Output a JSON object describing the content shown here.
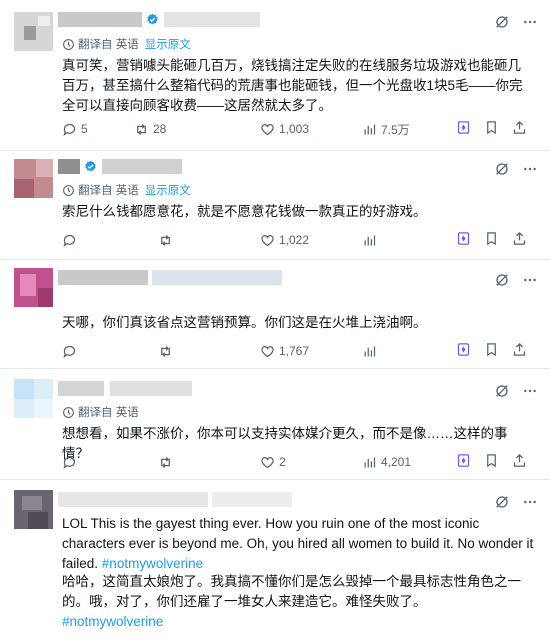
{
  "ui": {
    "translated_from": "翻译自 英语",
    "show_original": "显示原文"
  },
  "posts": [
    {
      "avatar_colors": [
        "#d6d6d6",
        "#9a9a9a",
        "#eeeeee"
      ],
      "name_blocks": [
        "#c9c9c9",
        "#e3e3e3"
      ],
      "verified": true,
      "show_translation": true,
      "text": "真可笑，营销噱头能砸几百万，烧钱搞注定失败的在线服务垃圾游戏也能砸几百万，甚至搞什么整箱代码的荒唐事也能砸钱，但一个光盘收1块5毛——你完全可以直接向顾客收费——这居然就太多了。",
      "replies": "5",
      "reposts": "28",
      "likes": "1,003",
      "views": "7.5万"
    },
    {
      "avatar_colors": [
        "#c48a92",
        "#a86370",
        "#d9b0b6"
      ],
      "name_blocks": [
        "#8f8f8f",
        "#d0d0d0"
      ],
      "verified": true,
      "show_translation": true,
      "text": "索尼什么钱都愿意花，就是不愿意花钱做一款真正的好游戏。",
      "replies": "",
      "reposts": "",
      "likes": "1,022",
      "views": ""
    },
    {
      "avatar_colors": [
        "#c0508e",
        "#e58bbc",
        "#9c3a70"
      ],
      "name_blocks": [
        "#c9c9c9",
        "#dbe3ec"
      ],
      "verified": false,
      "show_translation": false,
      "text": "天哪，你们真该省点这营销预算。你们这是在火堆上浇油啊。",
      "replies": "",
      "reposts": "",
      "likes": "1,767",
      "views": ""
    },
    {
      "avatar_colors": [
        "#dceefa",
        "#c6e3f7",
        "#eaf5fc"
      ],
      "name_blocks": [
        "#d4d4d4",
        "#e0e0e0"
      ],
      "verified": false,
      "show_translation": true,
      "text": "想想看，如果不涨价，你本可以支持实体媒介更久，而不是像……这样的事情？",
      "replies": "",
      "reposts": "",
      "likes": "2",
      "views": "4,201"
    },
    {
      "avatar_colors": [
        "#6b6470",
        "#8c8591",
        "#4f4a55"
      ],
      "name_blocks": [
        "#e6e6e6",
        "#ededed"
      ],
      "verified": false,
      "show_translation": false,
      "text_en": "LOL This is the gayest thing ever. How you ruin one of the most iconic characters ever is beyond me. Oh, you hired all women to build it. No wonder it failed.",
      "tag_en": "#notmywolverine",
      "text_zh": "哈哈，这简直太娘炮了。我真搞不懂你们是怎么毁掉一个最具标志性角色之一的。哦，对了，你们还雇了一堆女人来建造它。难怪失败了。",
      "tag_zh": "#notmywolverine"
    }
  ]
}
